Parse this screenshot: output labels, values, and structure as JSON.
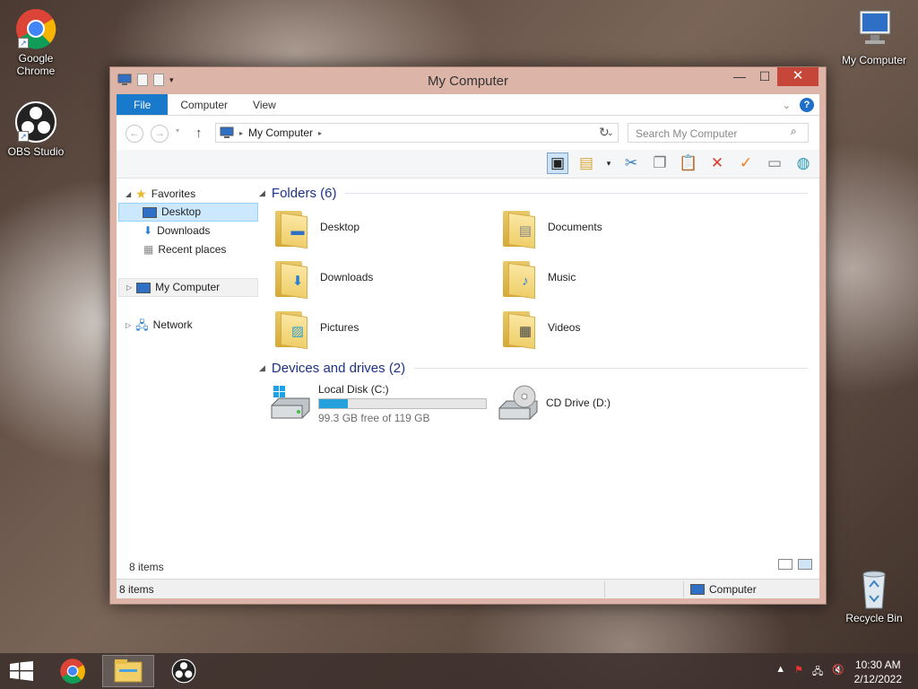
{
  "desktop": {
    "icons": [
      {
        "label": "Google Chrome"
      },
      {
        "label": "OBS Studio"
      },
      {
        "label": "My Computer"
      },
      {
        "label": "Recycle Bin"
      }
    ]
  },
  "window": {
    "title": "My Computer",
    "buttons": {
      "minimize": "—",
      "maximize": "☐",
      "close": "✕"
    }
  },
  "ribbon": {
    "tabs": [
      "File",
      "Computer",
      "View"
    ],
    "help": "?"
  },
  "address": {
    "path": "My Computer",
    "search_placeholder": "Search My Computer"
  },
  "nav": {
    "favorites": "Favorites",
    "items": [
      "Desktop",
      "Downloads",
      "Recent places"
    ],
    "computer": "My Computer",
    "network": "Network"
  },
  "content": {
    "folders_header": "Folders (6)",
    "folders": [
      "Desktop",
      "Documents",
      "Downloads",
      "Music",
      "Pictures",
      "Videos"
    ],
    "drives_header": "Devices and drives (2)",
    "drives": [
      {
        "name": "Local Disk (C:)",
        "free": "99.3 GB free of 119 GB",
        "used_fraction": 0.17
      },
      {
        "name": "CD Drive (D:)"
      }
    ],
    "item_count": "8 items"
  },
  "statusbar": {
    "items": "8 items",
    "location": "Computer"
  },
  "taskbar": {
    "time": "10:30 AM",
    "date": "2/12/2022"
  },
  "colors": {
    "accent": "#1979ca",
    "progress": "#26a0da",
    "close": "#c7463a"
  }
}
